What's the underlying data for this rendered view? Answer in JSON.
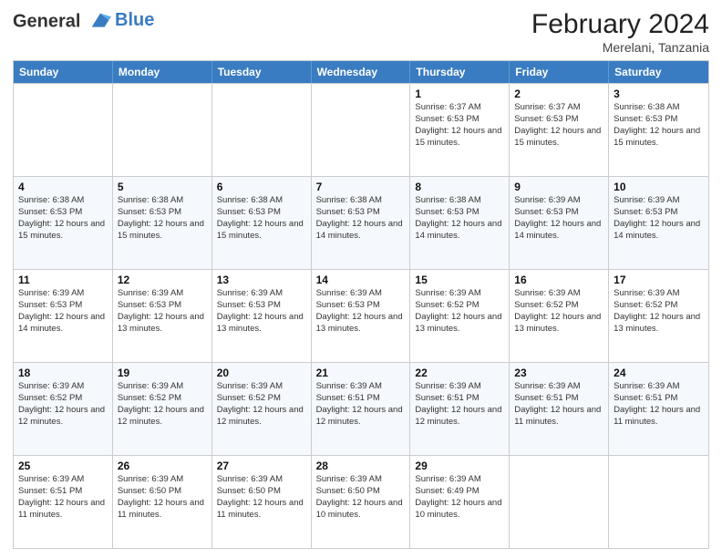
{
  "header": {
    "logo_line1": "General",
    "logo_line2": "Blue",
    "month_year": "February 2024",
    "location": "Merelani, Tanzania"
  },
  "weekdays": [
    "Sunday",
    "Monday",
    "Tuesday",
    "Wednesday",
    "Thursday",
    "Friday",
    "Saturday"
  ],
  "rows": [
    [
      {
        "day": "",
        "info": ""
      },
      {
        "day": "",
        "info": ""
      },
      {
        "day": "",
        "info": ""
      },
      {
        "day": "",
        "info": ""
      },
      {
        "day": "1",
        "info": "Sunrise: 6:37 AM\nSunset: 6:53 PM\nDaylight: 12 hours and 15 minutes."
      },
      {
        "day": "2",
        "info": "Sunrise: 6:37 AM\nSunset: 6:53 PM\nDaylight: 12 hours and 15 minutes."
      },
      {
        "day": "3",
        "info": "Sunrise: 6:38 AM\nSunset: 6:53 PM\nDaylight: 12 hours and 15 minutes."
      }
    ],
    [
      {
        "day": "4",
        "info": "Sunrise: 6:38 AM\nSunset: 6:53 PM\nDaylight: 12 hours and 15 minutes."
      },
      {
        "day": "5",
        "info": "Sunrise: 6:38 AM\nSunset: 6:53 PM\nDaylight: 12 hours and 15 minutes."
      },
      {
        "day": "6",
        "info": "Sunrise: 6:38 AM\nSunset: 6:53 PM\nDaylight: 12 hours and 15 minutes."
      },
      {
        "day": "7",
        "info": "Sunrise: 6:38 AM\nSunset: 6:53 PM\nDaylight: 12 hours and 14 minutes."
      },
      {
        "day": "8",
        "info": "Sunrise: 6:38 AM\nSunset: 6:53 PM\nDaylight: 12 hours and 14 minutes."
      },
      {
        "day": "9",
        "info": "Sunrise: 6:39 AM\nSunset: 6:53 PM\nDaylight: 12 hours and 14 minutes."
      },
      {
        "day": "10",
        "info": "Sunrise: 6:39 AM\nSunset: 6:53 PM\nDaylight: 12 hours and 14 minutes."
      }
    ],
    [
      {
        "day": "11",
        "info": "Sunrise: 6:39 AM\nSunset: 6:53 PM\nDaylight: 12 hours and 14 minutes."
      },
      {
        "day": "12",
        "info": "Sunrise: 6:39 AM\nSunset: 6:53 PM\nDaylight: 12 hours and 13 minutes."
      },
      {
        "day": "13",
        "info": "Sunrise: 6:39 AM\nSunset: 6:53 PM\nDaylight: 12 hours and 13 minutes."
      },
      {
        "day": "14",
        "info": "Sunrise: 6:39 AM\nSunset: 6:53 PM\nDaylight: 12 hours and 13 minutes."
      },
      {
        "day": "15",
        "info": "Sunrise: 6:39 AM\nSunset: 6:52 PM\nDaylight: 12 hours and 13 minutes."
      },
      {
        "day": "16",
        "info": "Sunrise: 6:39 AM\nSunset: 6:52 PM\nDaylight: 12 hours and 13 minutes."
      },
      {
        "day": "17",
        "info": "Sunrise: 6:39 AM\nSunset: 6:52 PM\nDaylight: 12 hours and 13 minutes."
      }
    ],
    [
      {
        "day": "18",
        "info": "Sunrise: 6:39 AM\nSunset: 6:52 PM\nDaylight: 12 hours and 12 minutes."
      },
      {
        "day": "19",
        "info": "Sunrise: 6:39 AM\nSunset: 6:52 PM\nDaylight: 12 hours and 12 minutes."
      },
      {
        "day": "20",
        "info": "Sunrise: 6:39 AM\nSunset: 6:52 PM\nDaylight: 12 hours and 12 minutes."
      },
      {
        "day": "21",
        "info": "Sunrise: 6:39 AM\nSunset: 6:51 PM\nDaylight: 12 hours and 12 minutes."
      },
      {
        "day": "22",
        "info": "Sunrise: 6:39 AM\nSunset: 6:51 PM\nDaylight: 12 hours and 12 minutes."
      },
      {
        "day": "23",
        "info": "Sunrise: 6:39 AM\nSunset: 6:51 PM\nDaylight: 12 hours and 11 minutes."
      },
      {
        "day": "24",
        "info": "Sunrise: 6:39 AM\nSunset: 6:51 PM\nDaylight: 12 hours and 11 minutes."
      }
    ],
    [
      {
        "day": "25",
        "info": "Sunrise: 6:39 AM\nSunset: 6:51 PM\nDaylight: 12 hours and 11 minutes."
      },
      {
        "day": "26",
        "info": "Sunrise: 6:39 AM\nSunset: 6:50 PM\nDaylight: 12 hours and 11 minutes."
      },
      {
        "day": "27",
        "info": "Sunrise: 6:39 AM\nSunset: 6:50 PM\nDaylight: 12 hours and 11 minutes."
      },
      {
        "day": "28",
        "info": "Sunrise: 6:39 AM\nSunset: 6:50 PM\nDaylight: 12 hours and 10 minutes."
      },
      {
        "day": "29",
        "info": "Sunrise: 6:39 AM\nSunset: 6:49 PM\nDaylight: 12 hours and 10 minutes."
      },
      {
        "day": "",
        "info": ""
      },
      {
        "day": "",
        "info": ""
      }
    ]
  ]
}
